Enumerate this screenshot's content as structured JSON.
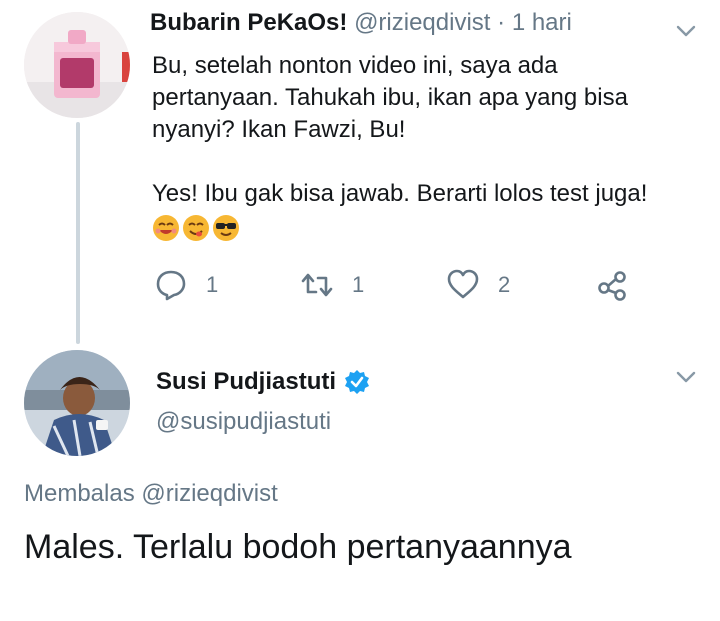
{
  "tweet1": {
    "display_name": "Bubarin PeKaOs!",
    "handle": "@rizieqdivist",
    "separator": "·",
    "time": "1 hari",
    "text_lines": [
      "Bu, setelah nonton video ini, saya ada",
      "pertanyaan. Tahukah ibu, ikan apa yang bisa",
      "nyanyi? Ikan Fawzi, Bu!"
    ],
    "text_line2": "Yes! Ibu gak bisa jawab. Berarti lolos test juga!",
    "emojis": [
      "smiling-face-icon",
      "savoring-face-icon",
      "sunglasses-face-icon"
    ],
    "actions": {
      "reply_count": "1",
      "retweet_count": "1",
      "like_count": "2"
    }
  },
  "tweet2": {
    "display_name": "Susi Pudjiastuti",
    "handle": "@susipudjiastuti",
    "replying_prefix": "Membalas",
    "replying_to": "@rizieqdivist",
    "text": "Males. Terlalu bodoh pertanyaannya"
  },
  "colors": {
    "text": "#14171a",
    "muted": "#657786",
    "verified": "#1da1f2",
    "thread_line": "#ccd6dd"
  }
}
